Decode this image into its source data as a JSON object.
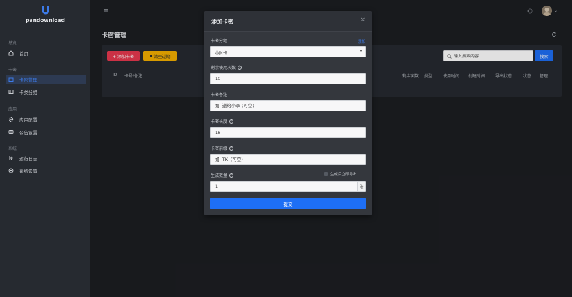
{
  "app": {
    "name": "pandownload"
  },
  "sidebar": {
    "sections": [
      {
        "label": "总览",
        "items": [
          {
            "label": "首页",
            "icon": "home-icon"
          }
        ]
      },
      {
        "label": "卡密",
        "items": [
          {
            "label": "卡密管理",
            "icon": "card-icon",
            "active": true
          },
          {
            "label": "卡类分组",
            "icon": "folder-icon"
          }
        ]
      },
      {
        "label": "应用",
        "items": [
          {
            "label": "应用配置",
            "icon": "gear-icon"
          },
          {
            "label": "公告设置",
            "icon": "notice-icon"
          }
        ]
      },
      {
        "label": "系统",
        "items": [
          {
            "label": "运行日志",
            "icon": "log-icon"
          },
          {
            "label": "系统设置",
            "icon": "settings-icon"
          }
        ]
      }
    ]
  },
  "page": {
    "title": "卡密管理"
  },
  "toolbar": {
    "add_label": "+ 添加卡密",
    "clear_label": "清空过期"
  },
  "table": {
    "columns": [
      "ID",
      "卡号/备注",
      "剩余次数",
      "类型",
      "使用时间",
      "创建时间",
      "导出状态",
      "状态",
      "管理"
    ]
  },
  "search": {
    "placeholder": "输入搜索内容",
    "button": "搜索"
  },
  "modal": {
    "title": "添加卡密",
    "close": "×",
    "group": {
      "label": "卡密分组",
      "link": "添加",
      "value": "小时卡"
    },
    "uses": {
      "label": "剩余使用次数",
      "value": "10"
    },
    "remark": {
      "label": "卡密备注",
      "placeholder": "如: 送给小李 (可空)"
    },
    "length": {
      "label": "卡密长度",
      "value": "18"
    },
    "prefix": {
      "label": "卡密前缀",
      "placeholder": "如: TK- (可空)"
    },
    "count": {
      "label": "生成数量",
      "value": "1",
      "suffix": "张",
      "checkbox_label": "生成后立即导出"
    },
    "submit": "提交"
  },
  "colors": {
    "accent": "#1e6ff5",
    "danger": "#e8384f",
    "warning": "#f5b000",
    "sidebar_bg": "#262a30"
  }
}
